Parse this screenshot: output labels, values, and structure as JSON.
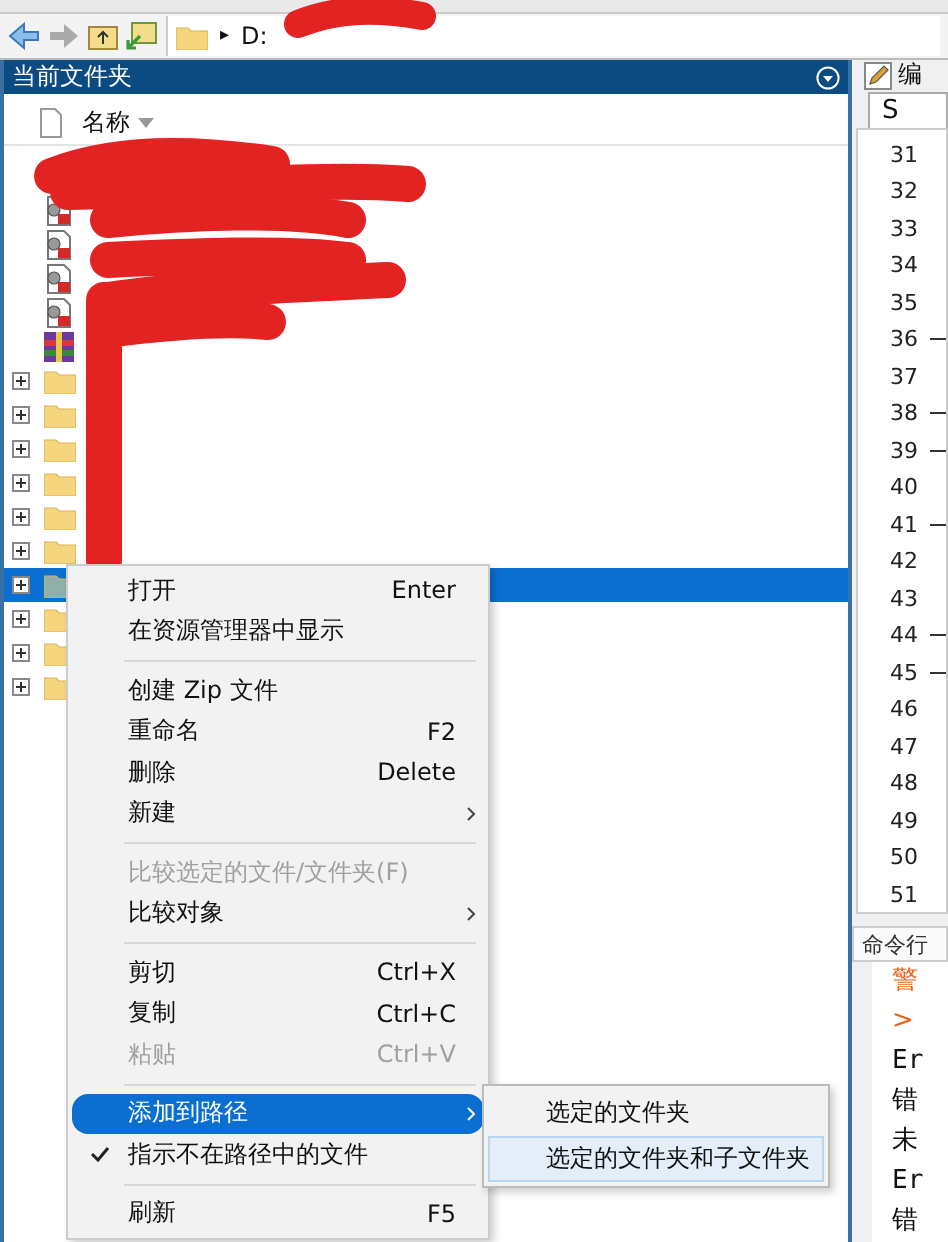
{
  "address_bar": {
    "drive": "D:",
    "separator": "▸"
  },
  "current_folder": {
    "title": "当前文件夹",
    "column": "名称",
    "items": [
      {
        "kind": "script",
        "selected": false
      },
      {
        "kind": "script",
        "selected": false
      },
      {
        "kind": "script",
        "selected": false
      },
      {
        "kind": "script",
        "selected": false
      },
      {
        "kind": "archive",
        "selected": false
      },
      {
        "kind": "folder",
        "selected": false
      },
      {
        "kind": "folder",
        "selected": false
      },
      {
        "kind": "folder",
        "selected": false
      },
      {
        "kind": "folder",
        "selected": false
      },
      {
        "kind": "folder",
        "selected": false
      },
      {
        "kind": "folder",
        "selected": false
      },
      {
        "kind": "folder",
        "selected": true
      },
      {
        "kind": "folder",
        "selected": false
      },
      {
        "kind": "folder",
        "selected": false
      },
      {
        "kind": "folder",
        "selected": false
      }
    ]
  },
  "editor": {
    "title": "编",
    "tab": "S",
    "lines": [
      {
        "number": "31",
        "marker": false
      },
      {
        "number": "32",
        "marker": false
      },
      {
        "number": "33",
        "marker": false
      },
      {
        "number": "34",
        "marker": false
      },
      {
        "number": "35",
        "marker": false
      },
      {
        "number": "36",
        "marker": true
      },
      {
        "number": "37",
        "marker": false
      },
      {
        "number": "38",
        "marker": true
      },
      {
        "number": "39",
        "marker": true
      },
      {
        "number": "40",
        "marker": false
      },
      {
        "number": "41",
        "marker": true
      },
      {
        "number": "42",
        "marker": false
      },
      {
        "number": "43",
        "marker": false
      },
      {
        "number": "44",
        "marker": true
      },
      {
        "number": "45",
        "marker": true
      },
      {
        "number": "46",
        "marker": false
      },
      {
        "number": "47",
        "marker": false
      },
      {
        "number": "48",
        "marker": false
      },
      {
        "number": "49",
        "marker": false
      },
      {
        "number": "50",
        "marker": false
      },
      {
        "number": "51",
        "marker": false
      }
    ]
  },
  "command_window": {
    "title": "命令行",
    "lines": [
      {
        "kind": "warning",
        "text": "警"
      },
      {
        "kind": "warning",
        "text": ">"
      },
      {
        "kind": "mono",
        "text": "Er"
      },
      {
        "kind": "plain",
        "text": "错"
      },
      {
        "kind": "plain",
        "text": "未"
      },
      {
        "kind": "mono",
        "text": "Er"
      },
      {
        "kind": "plain",
        "text": "错"
      }
    ]
  },
  "context_menu": {
    "groups": [
      [
        {
          "label": "打开",
          "shortcut": "Enter",
          "disabled": false,
          "highlighted": false,
          "checked": false,
          "submenu": false
        },
        {
          "label": "在资源管理器中显示",
          "disabled": false,
          "highlighted": false,
          "checked": false,
          "submenu": false
        }
      ],
      [
        {
          "label": "创建 Zip 文件",
          "disabled": false,
          "highlighted": false,
          "checked": false,
          "submenu": false
        },
        {
          "label": "重命名",
          "shortcut": "F2",
          "disabled": false,
          "highlighted": false,
          "checked": false,
          "submenu": false
        },
        {
          "label": "删除",
          "shortcut": "Delete",
          "disabled": false,
          "highlighted": false,
          "checked": false,
          "submenu": false
        },
        {
          "label": "新建",
          "disabled": false,
          "highlighted": false,
          "checked": false,
          "submenu": true
        }
      ],
      [
        {
          "label": "比较选定的文件/文件夹(F)",
          "disabled": true,
          "highlighted": false,
          "checked": false,
          "submenu": false
        },
        {
          "label": "比较对象",
          "disabled": false,
          "highlighted": false,
          "checked": false,
          "submenu": true
        }
      ],
      [
        {
          "label": "剪切",
          "shortcut": "Ctrl+X",
          "disabled": false,
          "highlighted": false,
          "checked": false,
          "submenu": false
        },
        {
          "label": "复制",
          "shortcut": "Ctrl+C",
          "disabled": false,
          "highlighted": false,
          "checked": false,
          "submenu": false
        },
        {
          "label": "粘贴",
          "shortcut": "Ctrl+V",
          "disabled": true,
          "highlighted": false,
          "checked": false,
          "submenu": false
        }
      ],
      [
        {
          "label": "添加到路径",
          "disabled": false,
          "highlighted": true,
          "checked": false,
          "submenu": true
        },
        {
          "label": "指示不在路径中的文件",
          "disabled": false,
          "highlighted": false,
          "checked": true,
          "submenu": false
        }
      ],
      [
        {
          "label": "刷新",
          "shortcut": "F5",
          "disabled": false,
          "highlighted": false,
          "checked": false,
          "submenu": false
        }
      ]
    ]
  },
  "submenu": {
    "items": [
      {
        "label": "选定的文件夹",
        "highlighted": false
      },
      {
        "label": "选定的文件夹和子文件夹",
        "highlighted": true
      }
    ]
  }
}
